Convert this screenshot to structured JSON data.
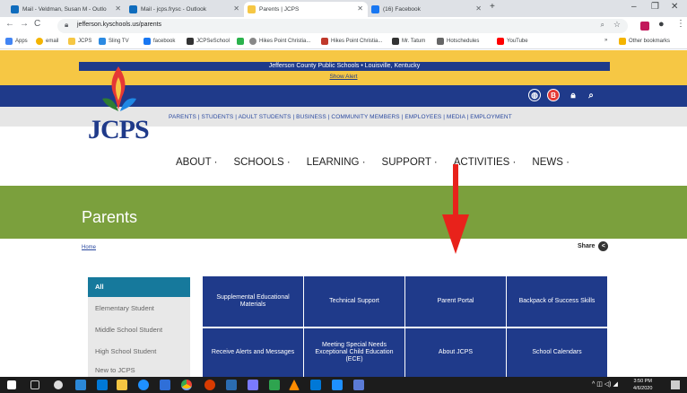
{
  "browser": {
    "tabs": [
      {
        "label": "Mail - Veldman, Susan M - Outlo",
        "icon_color": "#0f6cbd"
      },
      {
        "label": "Mail - jcps.frysc - Outlook",
        "icon_color": "#0f6cbd"
      },
      {
        "label": "Parents | JCPS",
        "icon_color": "#f6c744"
      },
      {
        "label": "(16) Facebook",
        "icon_color": "#1877f2"
      }
    ],
    "new_tab": "+",
    "url": "jefferson.kyschools.us/parents",
    "window_controls": [
      "–",
      "❐",
      "✕"
    ],
    "bookmarks": [
      {
        "label": "Apps",
        "color": "#4285f4"
      },
      {
        "label": "email",
        "color": "#f4b400"
      },
      {
        "label": "JCPS",
        "color": "#f6c744"
      },
      {
        "label": "Sling TV",
        "color": "#2b8ae2"
      },
      {
        "label": "facebook",
        "color": "#1877f2"
      },
      {
        "label": "JCPSeSchool",
        "color": "#333333"
      },
      {
        "label": "",
        "color": "#2bb24c"
      },
      {
        "label": "Hikes Point Christia...",
        "color": "#888888"
      },
      {
        "label": "Hikes Point Christia...",
        "color": "#c0392b"
      },
      {
        "label": "Mr. Tatum",
        "color": "#333333"
      },
      {
        "label": "Hotschedules",
        "color": "#666666"
      },
      {
        "label": "YouTube",
        "color": "#ff0000"
      }
    ],
    "other_bookmarks": "Other bookmarks",
    "overflow": "»"
  },
  "site": {
    "district_line": "Jefferson County Public Schools • Louisville, Kentucky",
    "show_alert": "Show Alert",
    "logo": "JCPS",
    "audience_links": "PARENTS  |  STUDENTS  |  ADULT STUDENTS  |  BUSINESS  |  COMMUNITY MEMBERS  |  EMPLOYEES  |  MEDIA  |  EMPLOYMENT",
    "main_nav": [
      "ABOUT ·",
      "SCHOOLS ·",
      "LEARNING ·",
      "SUPPORT ·",
      "ACTIVITIES ·",
      "NEWS ·"
    ],
    "header_icons": [
      "globe-icon",
      "b-icon",
      "lock-icon",
      "search-icon"
    ],
    "page_title": "Parents",
    "breadcrumb_home": "Home",
    "share_label": "Share",
    "sidebar": [
      "All",
      "Elementary Student",
      "Middle School Student",
      "High School Student",
      "New to JCPS"
    ],
    "tiles": [
      "Supplemental Educational Materials",
      "Technical Support",
      "Parent Portal",
      "Backpack of Success Skills",
      "Receive Alerts and Messages",
      "Meeting Special Needs Exceptional Child Education (ECE)",
      "About JCPS",
      "School Calendars"
    ],
    "colors": {
      "yellow": "#f6c744",
      "navy": "#1f3a8a",
      "green": "#7ba03d",
      "teal": "#16799c",
      "arrow": "#e8221b"
    }
  },
  "taskbar": {
    "time": "3:50 PM",
    "date": "4/6/2020"
  }
}
